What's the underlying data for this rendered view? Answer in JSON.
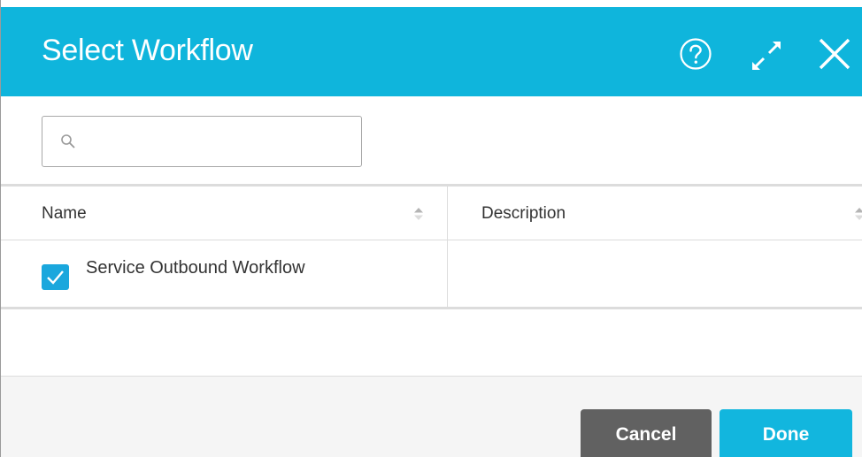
{
  "dialog": {
    "title": "Select Workflow"
  },
  "search": {
    "value": "",
    "placeholder": ""
  },
  "table": {
    "columns": [
      "Name",
      "Description"
    ],
    "rows": [
      {
        "name": "Service Outbound Workflow",
        "description": "",
        "checked": true
      }
    ]
  },
  "footer": {
    "cancel_label": "Cancel",
    "done_label": "Done"
  },
  "icons": {
    "help": "help-icon",
    "expand": "expand-icon",
    "close": "close-icon",
    "search": "search-icon",
    "sort": "sort-icon",
    "check": "checkmark-icon"
  },
  "colors": {
    "titlebar": "#0fb5dc",
    "checkbox": "#1aa7dd",
    "cancel": "#616161",
    "done": "#12b6de"
  }
}
